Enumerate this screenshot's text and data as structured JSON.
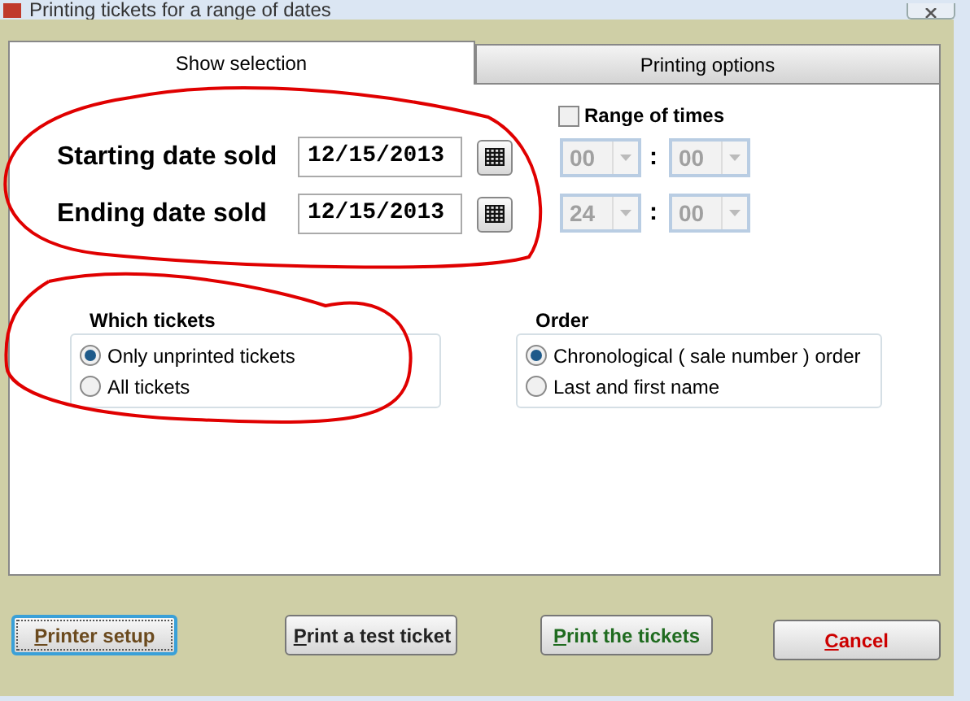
{
  "window": {
    "title": "Printing tickets for a range of dates"
  },
  "tabs": [
    {
      "label": "Show selection",
      "selected": true
    },
    {
      "label": "Printing options",
      "selected": false
    }
  ],
  "dates": [
    {
      "label": "Starting date sold",
      "value": "12/15/2013"
    },
    {
      "label": "Ending date sold",
      "value": "12/15/2013"
    }
  ],
  "range_of_times": {
    "label": "Range of times",
    "checked": false,
    "rows": [
      {
        "hour": "00",
        "separator": ":",
        "minute": "00"
      },
      {
        "hour": "24",
        "separator": ":",
        "minute": "00"
      }
    ]
  },
  "which_tickets": {
    "title": "Which tickets",
    "options": [
      {
        "label": "Only unprinted tickets",
        "selected": true
      },
      {
        "label": "All tickets",
        "selected": false
      }
    ]
  },
  "order": {
    "title": "Order",
    "options": [
      {
        "label": "Chronological ( sale number ) order",
        "selected": true
      },
      {
        "label": "Last and first name",
        "selected": false
      }
    ]
  },
  "buttons": [
    {
      "label": "Printer setup",
      "color": "#6b4a1e",
      "focused": true
    },
    {
      "label": "Print a test ticket",
      "color": "#222222",
      "focused": false
    },
    {
      "label": "Print the tickets",
      "color": "#1f6b1f",
      "focused": false
    },
    {
      "label": "Cancel",
      "color": "#cc0000",
      "focused": false
    }
  ]
}
